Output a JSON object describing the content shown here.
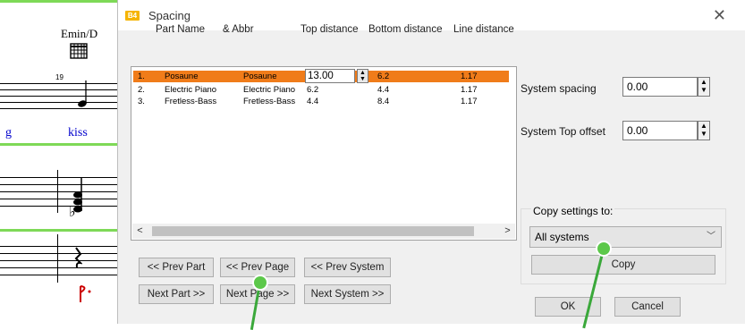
{
  "score": {
    "chord_symbol": "Emin/D",
    "measure_number": "19",
    "lyric_left": "g",
    "lyric_word": "kiss"
  },
  "dialog": {
    "icon_text": "B4",
    "title": "Spacing",
    "close_glyph": "✕",
    "columns": [
      "Part Name",
      "& Abbr",
      "Top distance",
      "Bottom distance",
      "Line distance"
    ],
    "rows": [
      {
        "num": "1.",
        "name": "Posaune",
        "abbr": "Posaune",
        "top": "13.00",
        "bottom": "6.2",
        "line": "1.17",
        "selected": true
      },
      {
        "num": "2.",
        "name": "Electric Piano",
        "abbr": "Electric Piano",
        "top": "6.2",
        "bottom": "4.4",
        "line": "1.17",
        "selected": false
      },
      {
        "num": "3.",
        "name": "Fretless-Bass",
        "abbr": "Fretless-Bass",
        "top": "4.4",
        "bottom": "8.4",
        "line": "1.17",
        "selected": false
      }
    ],
    "scroll_left": "<",
    "scroll_right": ">",
    "buttons": {
      "prev_part": "<< Prev Part",
      "prev_page": "<< Prev Page",
      "prev_system": "<< Prev System",
      "next_part": "Next Part >>",
      "next_page": "Next Page >>",
      "next_system": "Next System >>",
      "copy": "Copy",
      "ok": "OK",
      "cancel": "Cancel"
    },
    "system_spacing": {
      "label": "System spacing",
      "value": "0.00"
    },
    "system_top_offset": {
      "label": "System Top offset",
      "value": "0.00"
    },
    "copy_settings": {
      "title": "Copy settings to:",
      "selected": "All systems"
    }
  },
  "colors": {
    "selection": "#f07c1a",
    "annotation": "#5cc84a",
    "staff_highlight": "#7ed957",
    "lyric": "#0000cc"
  }
}
